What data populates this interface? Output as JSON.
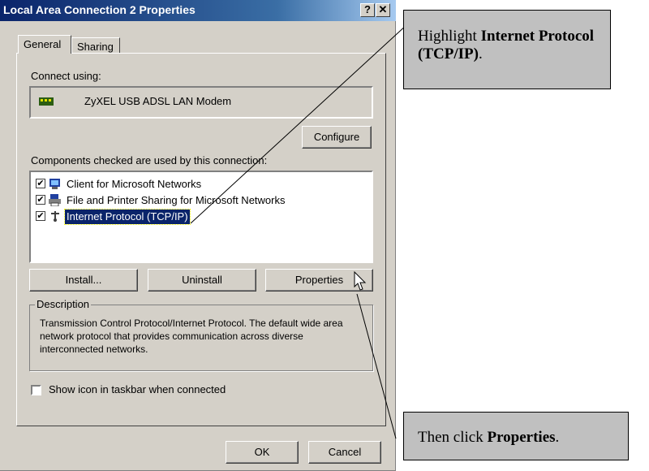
{
  "dialog": {
    "title": "Local Area Connection 2 Properties",
    "help_btn": "?",
    "close_btn": "✕",
    "tabs": [
      "General",
      "Sharing"
    ],
    "connect_using_label": "Connect using:",
    "adapter_name": "ZyXEL USB ADSL LAN Modem",
    "configure_label": "Configure",
    "components_label": "Components checked are used by this connection:",
    "components": [
      {
        "label": "Client for Microsoft Networks",
        "checked": true,
        "icon": "network-client-icon"
      },
      {
        "label": "File and Printer Sharing for Microsoft Networks",
        "checked": true,
        "icon": "printer-sharing-icon"
      },
      {
        "label": "Internet Protocol (TCP/IP)",
        "checked": true,
        "icon": "protocol-icon",
        "selected": true
      }
    ],
    "install_label": "Install...",
    "uninstall_label": "Uninstall",
    "properties_label": "Properties",
    "description_title": "Description",
    "description_text": "Transmission Control Protocol/Internet Protocol. The default wide area network protocol that provides communication across diverse interconnected networks.",
    "show_icon_label": "Show icon in taskbar when connected",
    "show_icon_checked": false,
    "ok_label": "OK",
    "cancel_label": "Cancel",
    "checkmark": "✔"
  },
  "callouts": {
    "top_prefix": "Highlight ",
    "top_bold": "Internet Protocol (TCP/IP)",
    "top_suffix": ".",
    "bottom_prefix": "Then click ",
    "bottom_bold": "Properties",
    "bottom_suffix": "."
  },
  "colors": {
    "dialog_bg": "#d4d0c8",
    "titlebar": "#0a246a",
    "selection": "#0a246a",
    "callout_bg": "#c0c0c0"
  }
}
